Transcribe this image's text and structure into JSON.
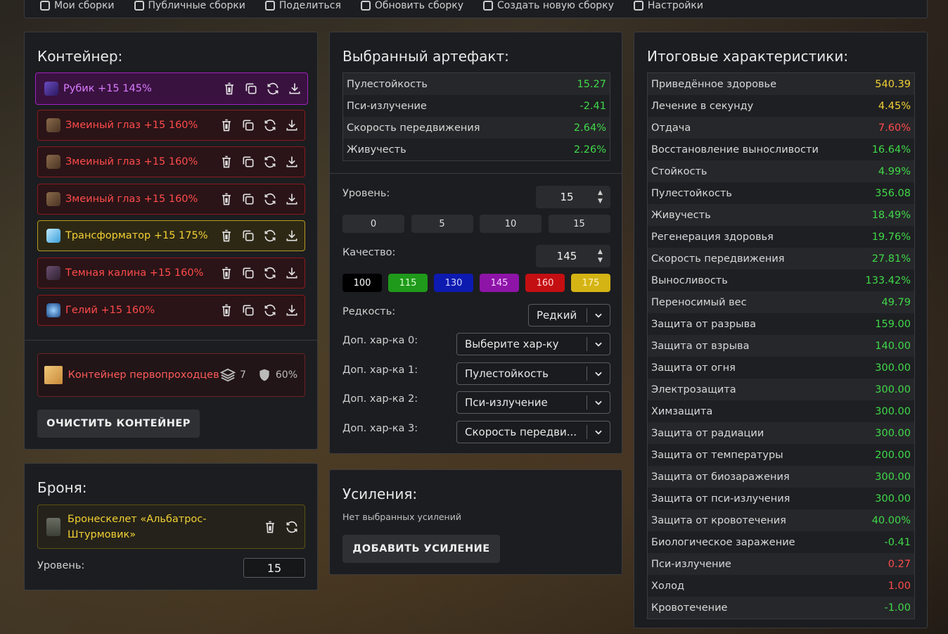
{
  "topbar": {
    "items": [
      {
        "label": "Мои сборки",
        "icon": "folder-icon"
      },
      {
        "label": "Публичные сборки",
        "icon": "globe-icon"
      },
      {
        "label": "Поделиться",
        "icon": "share-icon"
      },
      {
        "label": "Обновить сборку",
        "icon": "save-icon"
      },
      {
        "label": "Создать новую сборку",
        "icon": "plus-icon"
      },
      {
        "label": "Настройки",
        "icon": "gear-icon"
      }
    ]
  },
  "container": {
    "title": "Контейнер:",
    "artifacts": [
      {
        "label": "Рубик +15 145%",
        "rarity": "purple",
        "icon": "rubik-icon"
      },
      {
        "label": "Змеиный глаз +15 160%",
        "rarity": "red",
        "icon": "snake-eye-icon"
      },
      {
        "label": "Змеиный глаз +15 160%",
        "rarity": "red",
        "icon": "snake-eye-icon"
      },
      {
        "label": "Змеиный глаз +15 160%",
        "rarity": "red",
        "icon": "snake-eye-icon"
      },
      {
        "label": "Трансформатор +15 175%",
        "rarity": "yellow",
        "icon": "transformer-icon"
      },
      {
        "label": "Темная калина +15 160%",
        "rarity": "red",
        "icon": "dark-viburnum-icon"
      },
      {
        "label": "Гелий +15 160%",
        "rarity": "red",
        "icon": "helium-icon"
      }
    ],
    "card": {
      "name": "Контейнер первопроходцев",
      "slots": "7",
      "protection": "60%"
    },
    "clear_button": "ОЧИСТИТЬ КОНТЕЙНЕР"
  },
  "armor": {
    "title": "Броня:",
    "name": "Бронескелет «Альбатрос-Штурмовик»",
    "level_label": "Уровень:",
    "level_value": "15"
  },
  "selected": {
    "title": "Выбранный артефакт:",
    "stats": [
      {
        "name": "Пулестойкость",
        "value": "15.27",
        "color": "green"
      },
      {
        "name": "Пси-излучение",
        "value": "-2.41",
        "color": "green"
      },
      {
        "name": "Скорость передвижения",
        "value": "2.64%",
        "color": "green"
      },
      {
        "name": "Живучесть",
        "value": "2.26%",
        "color": "green"
      }
    ],
    "level_label": "Уровень:",
    "level_value": "15",
    "level_presets": [
      "0",
      "5",
      "10",
      "15"
    ],
    "quality_label": "Качество:",
    "quality_value": "145",
    "quality_presets": [
      {
        "label": "100",
        "bg": "#000000",
        "fg": "#ffffff"
      },
      {
        "label": "115",
        "bg": "#1f9a1a",
        "fg": "#d8ffd0"
      },
      {
        "label": "130",
        "bg": "#0d1ab0",
        "fg": "#d0d8ff"
      },
      {
        "label": "145",
        "bg": "#8e14a8",
        "fg": "#f4d0ff"
      },
      {
        "label": "160",
        "bg": "#c40f12",
        "fg": "#ffd8d8"
      },
      {
        "label": "175",
        "bg": "#d4b414",
        "fg": "#fff4c0"
      }
    ],
    "rarity_label": "Редкость:",
    "rarity_value": "Редкий",
    "extra": [
      {
        "label": "Доп. хар-ка 0:",
        "value": "Выберите хар-ку"
      },
      {
        "label": "Доп. хар-ка 1:",
        "value": "Пулестойкость"
      },
      {
        "label": "Доп. хар-ка 2:",
        "value": "Пси-излучение"
      },
      {
        "label": "Доп. хар-ка 3:",
        "value": "Скорость передви..."
      }
    ]
  },
  "boosts": {
    "title": "Усиления:",
    "empty_text": "Нет выбранных усилений",
    "add_button": "ДОБАВИТЬ УСИЛЕНИЕ"
  },
  "total": {
    "title": "Итоговые характеристики:",
    "stats": [
      {
        "name": "Приведённое здоровье",
        "value": "540.39",
        "color": "yellow"
      },
      {
        "name": "Лечение в секунду",
        "value": "4.45%",
        "color": "yellow"
      },
      {
        "name": "Отдача",
        "value": "7.60%",
        "color": "red"
      },
      {
        "name": "Восстановление выносливости",
        "value": "16.64%",
        "color": "green"
      },
      {
        "name": "Стойкость",
        "value": "4.99%",
        "color": "green"
      },
      {
        "name": "Пулестойкость",
        "value": "356.08",
        "color": "green"
      },
      {
        "name": "Живучесть",
        "value": "18.49%",
        "color": "green"
      },
      {
        "name": "Регенерация здоровья",
        "value": "19.76%",
        "color": "green"
      },
      {
        "name": "Скорость передвижения",
        "value": "27.81%",
        "color": "green"
      },
      {
        "name": "Выносливость",
        "value": "133.42%",
        "color": "green"
      },
      {
        "name": "Переносимый вес",
        "value": "49.79",
        "color": "green"
      },
      {
        "name": "Защита от разрыва",
        "value": "159.00",
        "color": "green"
      },
      {
        "name": "Защита от взрыва",
        "value": "140.00",
        "color": "green"
      },
      {
        "name": "Защита от огня",
        "value": "300.00",
        "color": "green"
      },
      {
        "name": "Электрозащита",
        "value": "300.00",
        "color": "green"
      },
      {
        "name": "Химзащита",
        "value": "300.00",
        "color": "green"
      },
      {
        "name": "Защита от радиации",
        "value": "300.00",
        "color": "green"
      },
      {
        "name": "Защита от температуры",
        "value": "200.00",
        "color": "green"
      },
      {
        "name": "Защита от биозаражения",
        "value": "300.00",
        "color": "green"
      },
      {
        "name": "Защита от пси-излучения",
        "value": "300.00",
        "color": "green"
      },
      {
        "name": "Защита от кровотечения",
        "value": "40.00%",
        "color": "green"
      },
      {
        "name": "Биологическое заражение",
        "value": "-0.41",
        "color": "green"
      },
      {
        "name": "Пси-излучение",
        "value": "0.27",
        "color": "red"
      },
      {
        "name": "Холод",
        "value": "1.00",
        "color": "red"
      },
      {
        "name": "Кровотечение",
        "value": "-1.00",
        "color": "green"
      }
    ]
  }
}
